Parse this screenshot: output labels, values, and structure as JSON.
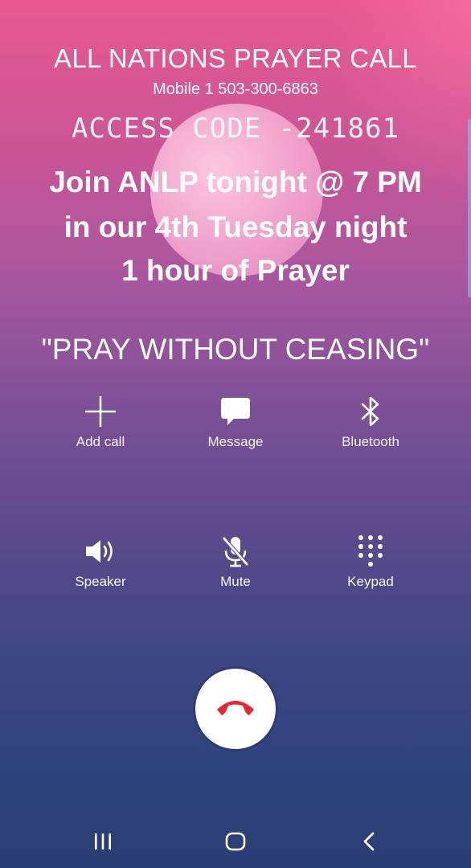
{
  "header": {
    "title": "ALL NATIONS PRAYER CALL",
    "mobile": "Mobile  1 503-300-6863",
    "access_code": "ACCESS CODE -241861"
  },
  "announcement": {
    "line1": "Join ANLP tonight @ 7 PM",
    "line2": "in our 4th Tuesday night",
    "line3": "1 hour of Prayer"
  },
  "quote": "\"PRAY WITHOUT CEASING\"",
  "controls": [
    {
      "label": "Add call",
      "icon": "plus-icon"
    },
    {
      "label": "Message",
      "icon": "message-icon"
    },
    {
      "label": "Bluetooth",
      "icon": "bluetooth-icon"
    },
    {
      "label": "Speaker",
      "icon": "speaker-icon"
    },
    {
      "label": "Mute",
      "icon": "mic-off-icon"
    },
    {
      "label": "Keypad",
      "icon": "keypad-icon"
    }
  ],
  "end_call": {
    "icon": "phone-hangup-icon",
    "color": "#e8262d"
  },
  "navbar": {
    "recents_icon": "recents-icon",
    "home_icon": "home-icon",
    "back_icon": "back-icon"
  },
  "colors": {
    "gradient_top": "#e8588f",
    "gradient_bottom": "#2c3f77",
    "end_call_red": "#e8262d",
    "text": "#ffffff"
  }
}
